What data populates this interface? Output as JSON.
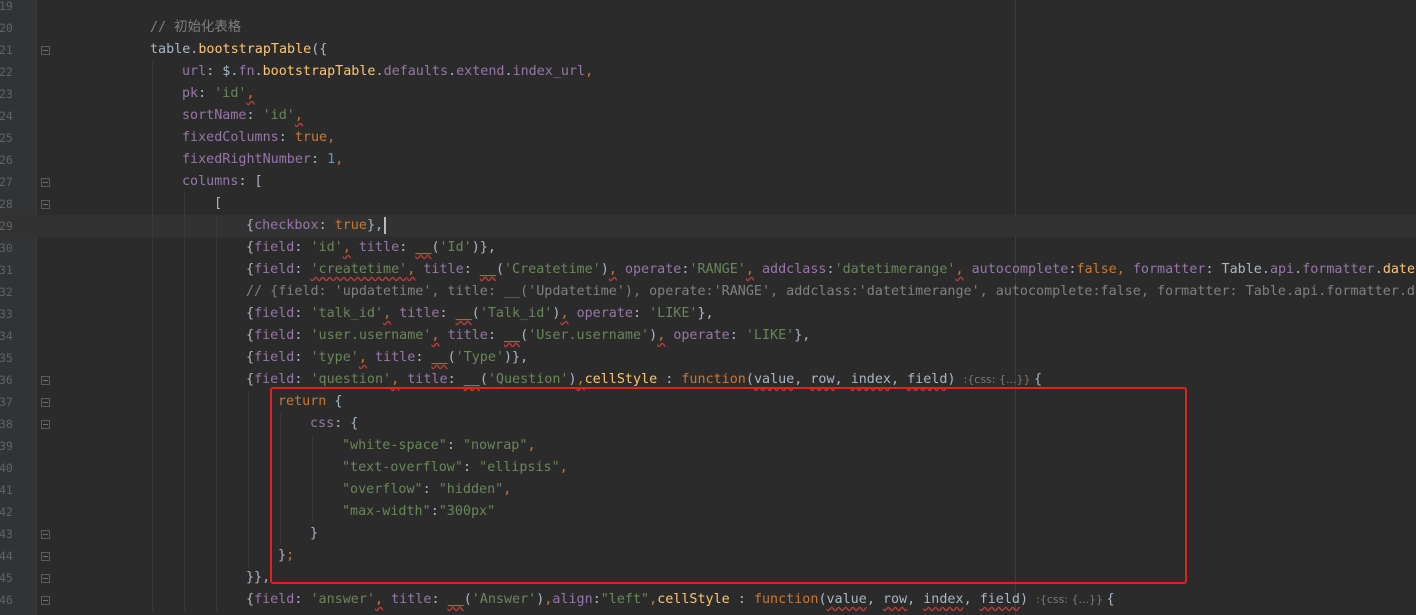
{
  "editor": {
    "lines": [
      {
        "no": "19",
        "fold": false,
        "tokens": []
      },
      {
        "no": "20",
        "fold": false,
        "tokens": [
          {
            "t": "// 初始化表格",
            "c": "comment"
          }
        ]
      },
      {
        "no": "21",
        "fold": true,
        "tokens": [
          {
            "t": "table.",
            "c": "plain"
          },
          {
            "t": "bootstrapTable",
            "c": "fn"
          },
          {
            "t": "({",
            "c": "plain"
          }
        ]
      },
      {
        "no": "22",
        "fold": false,
        "tokens": [
          {
            "t": "url",
            "c": "prop"
          },
          {
            "t": ": $.",
            "c": "plain"
          },
          {
            "t": "fn",
            "c": "prop"
          },
          {
            "t": ".",
            "c": "plain"
          },
          {
            "t": "bootstrapTable",
            "c": "fn"
          },
          {
            "t": ".",
            "c": "plain"
          },
          {
            "t": "defaults",
            "c": "prop"
          },
          {
            "t": ".",
            "c": "plain"
          },
          {
            "t": "extend",
            "c": "prop"
          },
          {
            "t": ".",
            "c": "plain"
          },
          {
            "t": "index_url",
            "c": "prop"
          },
          {
            "t": ",",
            "c": "kw"
          }
        ]
      },
      {
        "no": "23",
        "fold": false,
        "tokens": [
          {
            "t": "pk",
            "c": "prop"
          },
          {
            "t": ": ",
            "c": "plain"
          },
          {
            "t": "'id'",
            "c": "str"
          },
          {
            "t": ",",
            "c": "kw",
            "sq": true
          }
        ]
      },
      {
        "no": "24",
        "fold": false,
        "tokens": [
          {
            "t": "sortName",
            "c": "prop"
          },
          {
            "t": ": ",
            "c": "plain"
          },
          {
            "t": "'id'",
            "c": "str"
          },
          {
            "t": ",",
            "c": "kw",
            "sq": true
          }
        ]
      },
      {
        "no": "25",
        "fold": false,
        "tokens": [
          {
            "t": "fixedColumns",
            "c": "prop"
          },
          {
            "t": ": ",
            "c": "plain"
          },
          {
            "t": "true",
            "c": "kw"
          },
          {
            "t": ",",
            "c": "kw"
          }
        ]
      },
      {
        "no": "26",
        "fold": false,
        "tokens": [
          {
            "t": "fixedRightNumber",
            "c": "prop"
          },
          {
            "t": ": ",
            "c": "plain"
          },
          {
            "t": "1",
            "c": "num"
          },
          {
            "t": ",",
            "c": "kw"
          }
        ]
      },
      {
        "no": "27",
        "fold": true,
        "tokens": [
          {
            "t": "columns",
            "c": "prop"
          },
          {
            "t": ": [",
            "c": "plain"
          }
        ]
      },
      {
        "no": "28",
        "fold": true,
        "tokens": [
          {
            "t": "[",
            "c": "plain"
          }
        ]
      },
      {
        "no": "29",
        "fold": false,
        "current": true,
        "caret": true,
        "tokens": [
          {
            "t": "{",
            "c": "plain"
          },
          {
            "t": "checkbox",
            "c": "prop"
          },
          {
            "t": ": ",
            "c": "plain"
          },
          {
            "t": "true",
            "c": "kw"
          },
          {
            "t": "},",
            "c": "plain"
          }
        ]
      },
      {
        "no": "30",
        "fold": false,
        "tokens": [
          {
            "t": "{",
            "c": "plain"
          },
          {
            "t": "field",
            "c": "prop"
          },
          {
            "t": ": ",
            "c": "plain"
          },
          {
            "t": "'id'",
            "c": "str"
          },
          {
            "t": ",",
            "c": "kw",
            "sq": true
          },
          {
            "t": " ",
            "c": "plain"
          },
          {
            "t": "title",
            "c": "prop"
          },
          {
            "t": ": ",
            "c": "plain"
          },
          {
            "t": "__",
            "c": "fn",
            "sq": true
          },
          {
            "t": "(",
            "c": "plain"
          },
          {
            "t": "'Id'",
            "c": "str"
          },
          {
            "t": ")},",
            "c": "plain"
          }
        ]
      },
      {
        "no": "31",
        "fold": false,
        "tokens": [
          {
            "t": "{",
            "c": "plain"
          },
          {
            "t": "field",
            "c": "prop"
          },
          {
            "t": ": ",
            "c": "plain"
          },
          {
            "t": "'createtime'",
            "c": "str",
            "sq": true
          },
          {
            "t": ",",
            "c": "kw",
            "sq": true
          },
          {
            "t": " ",
            "c": "plain"
          },
          {
            "t": "title",
            "c": "prop"
          },
          {
            "t": ": ",
            "c": "plain"
          },
          {
            "t": "__",
            "c": "fn",
            "sq": true
          },
          {
            "t": "(",
            "c": "plain"
          },
          {
            "t": "'Createtime'",
            "c": "str"
          },
          {
            "t": ")",
            "c": "plain"
          },
          {
            "t": ",",
            "c": "kw",
            "sq": true
          },
          {
            "t": " ",
            "c": "plain"
          },
          {
            "t": "operate",
            "c": "prop"
          },
          {
            "t": ":",
            "c": "plain"
          },
          {
            "t": "'RANGE'",
            "c": "str"
          },
          {
            "t": ",",
            "c": "kw",
            "sq": true
          },
          {
            "t": " ",
            "c": "plain"
          },
          {
            "t": "addclass",
            "c": "prop"
          },
          {
            "t": ":",
            "c": "plain"
          },
          {
            "t": "'datetimerange'",
            "c": "str"
          },
          {
            "t": ",",
            "c": "kw",
            "sq": true
          },
          {
            "t": " ",
            "c": "plain"
          },
          {
            "t": "autocomplete",
            "c": "prop"
          },
          {
            "t": ":",
            "c": "plain"
          },
          {
            "t": "false",
            "c": "kw"
          },
          {
            "t": ", ",
            "c": "kw"
          },
          {
            "t": "formatter",
            "c": "prop"
          },
          {
            "t": ": Table.",
            "c": "plain"
          },
          {
            "t": "api",
            "c": "prop"
          },
          {
            "t": ".",
            "c": "plain"
          },
          {
            "t": "formatter",
            "c": "prop"
          },
          {
            "t": ".",
            "c": "plain"
          },
          {
            "t": "datetime",
            "c": "fn"
          }
        ]
      },
      {
        "no": "32",
        "fold": false,
        "tokens": [
          {
            "t": "// {field: 'updatetime', title: __('Updatetime'), operate:'RANGE', addclass:'datetimerange', autocomplete:false, formatter: Table.api.formatter.datetime}",
            "c": "comment"
          }
        ]
      },
      {
        "no": "33",
        "fold": false,
        "tokens": [
          {
            "t": "{",
            "c": "plain"
          },
          {
            "t": "field",
            "c": "prop"
          },
          {
            "t": ": ",
            "c": "plain"
          },
          {
            "t": "'talk_id'",
            "c": "str"
          },
          {
            "t": ",",
            "c": "kw",
            "sq": true
          },
          {
            "t": " ",
            "c": "plain"
          },
          {
            "t": "title",
            "c": "prop"
          },
          {
            "t": ": ",
            "c": "plain"
          },
          {
            "t": "__",
            "c": "fn",
            "sq": true
          },
          {
            "t": "(",
            "c": "plain"
          },
          {
            "t": "'Talk_id'",
            "c": "str"
          },
          {
            "t": ")",
            "c": "plain"
          },
          {
            "t": ",",
            "c": "kw",
            "sq": true
          },
          {
            "t": " ",
            "c": "plain"
          },
          {
            "t": "operate",
            "c": "prop"
          },
          {
            "t": ": ",
            "c": "plain"
          },
          {
            "t": "'LIKE'",
            "c": "str"
          },
          {
            "t": "},",
            "c": "plain"
          }
        ]
      },
      {
        "no": "34",
        "fold": false,
        "tokens": [
          {
            "t": "{",
            "c": "plain"
          },
          {
            "t": "field",
            "c": "prop"
          },
          {
            "t": ": ",
            "c": "plain"
          },
          {
            "t": "'user.username'",
            "c": "str"
          },
          {
            "t": ",",
            "c": "kw",
            "sq": true
          },
          {
            "t": " ",
            "c": "plain"
          },
          {
            "t": "title",
            "c": "prop"
          },
          {
            "t": ": ",
            "c": "plain"
          },
          {
            "t": "__",
            "c": "fn",
            "sq": true
          },
          {
            "t": "(",
            "c": "plain"
          },
          {
            "t": "'User.username'",
            "c": "str"
          },
          {
            "t": ")",
            "c": "plain"
          },
          {
            "t": ",",
            "c": "kw",
            "sq": true
          },
          {
            "t": " ",
            "c": "plain"
          },
          {
            "t": "operate",
            "c": "prop"
          },
          {
            "t": ": ",
            "c": "plain"
          },
          {
            "t": "'LIKE'",
            "c": "str"
          },
          {
            "t": "},",
            "c": "plain"
          }
        ]
      },
      {
        "no": "35",
        "fold": false,
        "tokens": [
          {
            "t": "{",
            "c": "plain"
          },
          {
            "t": "field",
            "c": "prop"
          },
          {
            "t": ": ",
            "c": "plain"
          },
          {
            "t": "'type'",
            "c": "str"
          },
          {
            "t": ",",
            "c": "kw",
            "sq": true
          },
          {
            "t": " ",
            "c": "plain"
          },
          {
            "t": "title",
            "c": "prop"
          },
          {
            "t": ": ",
            "c": "plain"
          },
          {
            "t": "__",
            "c": "fn",
            "sq": true
          },
          {
            "t": "(",
            "c": "plain"
          },
          {
            "t": "'Type'",
            "c": "str"
          },
          {
            "t": ")},",
            "c": "plain"
          }
        ]
      },
      {
        "no": "36",
        "fold": true,
        "tokens": [
          {
            "t": "{",
            "c": "plain"
          },
          {
            "t": "field",
            "c": "prop"
          },
          {
            "t": ": ",
            "c": "plain"
          },
          {
            "t": "'question'",
            "c": "str"
          },
          {
            "t": ",",
            "c": "kw",
            "sq": true
          },
          {
            "t": " ",
            "c": "plain"
          },
          {
            "t": "title",
            "c": "prop"
          },
          {
            "t": ": ",
            "c": "plain"
          },
          {
            "t": "__",
            "c": "fn",
            "sq": true
          },
          {
            "t": "(",
            "c": "plain"
          },
          {
            "t": "'Question'",
            "c": "str"
          },
          {
            "t": ")",
            "c": "plain"
          },
          {
            "t": ",",
            "c": "kw",
            "sq": true
          },
          {
            "t": "cellStyle",
            "c": "fn"
          },
          {
            "t": " : ",
            "c": "plain"
          },
          {
            "t": "function",
            "c": "kw"
          },
          {
            "t": "(",
            "c": "plain"
          },
          {
            "t": "value",
            "c": "plain",
            "sq": true
          },
          {
            "t": ", ",
            "c": "plain"
          },
          {
            "t": "row",
            "c": "plain",
            "sq": true
          },
          {
            "t": ", ",
            "c": "plain"
          },
          {
            "t": "index",
            "c": "plain",
            "sq": true
          },
          {
            "t": ", ",
            "c": "plain"
          },
          {
            "t": "field",
            "c": "plain",
            "sq": true
          },
          {
            "t": ") ",
            "c": "plain"
          },
          {
            "t": ":{css: {...}} ",
            "c": "hint"
          },
          {
            "t": "{",
            "c": "plain"
          }
        ]
      },
      {
        "no": "37",
        "fold": true,
        "tokens": [
          {
            "t": "return",
            "c": "kw"
          },
          {
            "t": " {",
            "c": "plain"
          }
        ]
      },
      {
        "no": "38",
        "fold": true,
        "tokens": [
          {
            "t": "css",
            "c": "prop"
          },
          {
            "t": ": {",
            "c": "plain"
          }
        ]
      },
      {
        "no": "39",
        "fold": false,
        "tokens": [
          {
            "t": "\"white-space\"",
            "c": "str"
          },
          {
            "t": ": ",
            "c": "plain"
          },
          {
            "t": "\"nowrap\"",
            "c": "str"
          },
          {
            "t": ",",
            "c": "kw"
          }
        ]
      },
      {
        "no": "40",
        "fold": false,
        "tokens": [
          {
            "t": "\"text-overflow\"",
            "c": "str"
          },
          {
            "t": ": ",
            "c": "plain"
          },
          {
            "t": "\"ellipsis\"",
            "c": "str"
          },
          {
            "t": ",",
            "c": "kw"
          }
        ]
      },
      {
        "no": "41",
        "fold": false,
        "tokens": [
          {
            "t": "\"overflow\"",
            "c": "str"
          },
          {
            "t": ": ",
            "c": "plain"
          },
          {
            "t": "\"hidden\"",
            "c": "str"
          },
          {
            "t": ",",
            "c": "kw"
          }
        ]
      },
      {
        "no": "42",
        "fold": false,
        "tokens": [
          {
            "t": "\"max-width\"",
            "c": "str"
          },
          {
            "t": ":",
            "c": "plain"
          },
          {
            "t": "\"300px\"",
            "c": "str"
          }
        ]
      },
      {
        "no": "43",
        "fold": true,
        "tokens": [
          {
            "t": "}",
            "c": "plain"
          }
        ]
      },
      {
        "no": "44",
        "fold": true,
        "tokens": [
          {
            "t": "}",
            "c": "plain"
          },
          {
            "t": ";",
            "c": "kw"
          }
        ]
      },
      {
        "no": "45",
        "fold": true,
        "tokens": [
          {
            "t": "}},",
            "c": "plain"
          }
        ]
      },
      {
        "no": "46",
        "fold": true,
        "tokens": [
          {
            "t": "{",
            "c": "plain"
          },
          {
            "t": "field",
            "c": "prop"
          },
          {
            "t": ": ",
            "c": "plain"
          },
          {
            "t": "'answer'",
            "c": "str"
          },
          {
            "t": ",",
            "c": "kw",
            "sq": true
          },
          {
            "t": " ",
            "c": "plain"
          },
          {
            "t": "title",
            "c": "prop"
          },
          {
            "t": ": ",
            "c": "plain"
          },
          {
            "t": "__",
            "c": "fn",
            "sq": true
          },
          {
            "t": "(",
            "c": "plain"
          },
          {
            "t": "'Answer'",
            "c": "str"
          },
          {
            "t": ")",
            "c": "plain"
          },
          {
            "t": ",",
            "c": "kw"
          },
          {
            "t": "align",
            "c": "prop"
          },
          {
            "t": ":",
            "c": "plain"
          },
          {
            "t": "\"left\"",
            "c": "str"
          },
          {
            "t": ",",
            "c": "kw"
          },
          {
            "t": "cellStyle",
            "c": "fn"
          },
          {
            "t": " : ",
            "c": "plain"
          },
          {
            "t": "function",
            "c": "kw"
          },
          {
            "t": "(",
            "c": "plain"
          },
          {
            "t": "value",
            "c": "plain",
            "sq": true
          },
          {
            "t": ", ",
            "c": "plain"
          },
          {
            "t": "row",
            "c": "plain",
            "sq": true
          },
          {
            "t": ", ",
            "c": "plain"
          },
          {
            "t": "index",
            "c": "plain",
            "sq": true
          },
          {
            "t": ", ",
            "c": "plain"
          },
          {
            "t": "field",
            "c": "plain",
            "sq": true
          },
          {
            "t": ") ",
            "c": "plain"
          },
          {
            "t": ":{css: {...}} ",
            "c": "hint"
          },
          {
            "t": "{",
            "c": "plain"
          }
        ]
      }
    ]
  },
  "colors": {
    "background": "#2b2b2b",
    "gutter": "#313335",
    "keyword": "#cc7832",
    "string": "#6a8759",
    "number": "#6897bb",
    "property": "#9876aa",
    "function": "#ffc66d",
    "comment": "#808080",
    "annotation_box": "#e0241c"
  }
}
